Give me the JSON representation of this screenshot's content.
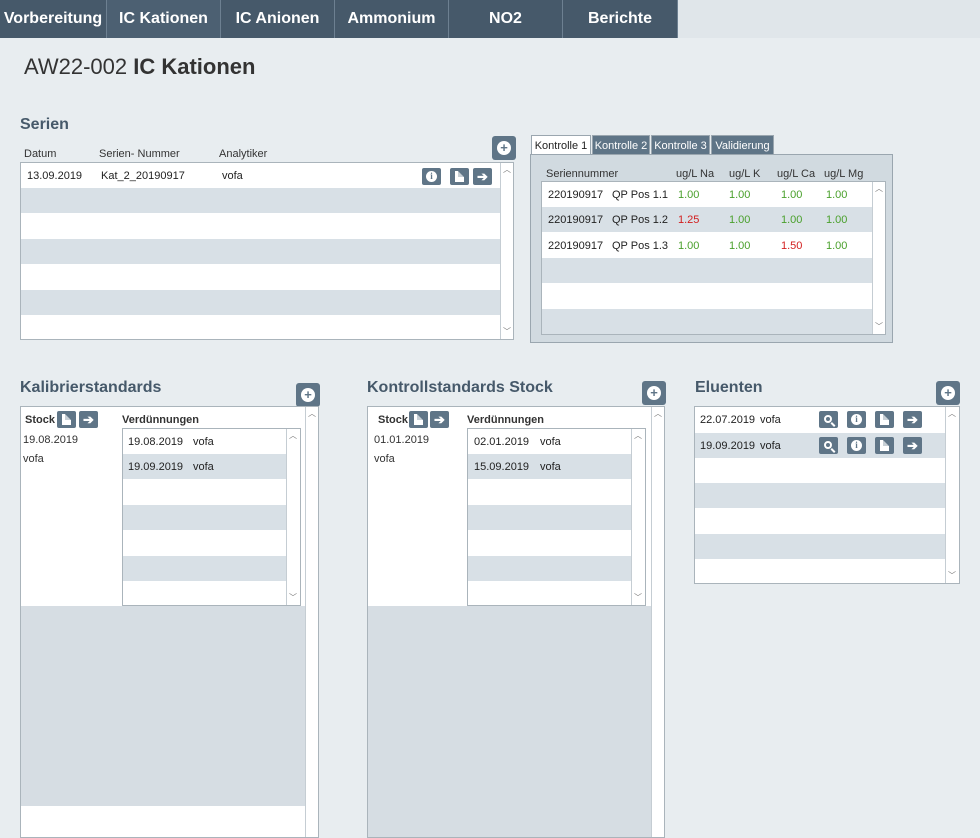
{
  "nav": {
    "tabs": [
      {
        "label": "Vorbereitung"
      },
      {
        "label": "IC Kationen"
      },
      {
        "label": "IC Anionen"
      },
      {
        "label": "Ammonium"
      },
      {
        "label": "NO2"
      },
      {
        "label": "Berichte"
      }
    ]
  },
  "page": {
    "code": "AW22-002",
    "title": "IC Kationen"
  },
  "serien": {
    "title": "Serien",
    "headers": {
      "datum": "Datum",
      "nummer": "Serien- Nummer",
      "analytiker": "Analytiker"
    },
    "rows": [
      {
        "datum": "13.09.2019",
        "nummer": "Kat_2_20190917",
        "analytiker": "vofa"
      }
    ]
  },
  "kontrolle": {
    "tabs": [
      "Kontrolle 1",
      "Kontrolle 2",
      "Kontrolle 3",
      "Validierung"
    ],
    "headers": [
      "Seriennummer",
      "ug/L Na",
      "ug/L K",
      "ug/L Ca",
      "ug/L Mg"
    ],
    "rows": [
      {
        "serie": "220190917",
        "pos": "QP Pos 1.1",
        "na": "1.00",
        "k": "1.00",
        "ca": "1.00",
        "mg": "1.00"
      },
      {
        "serie": "220190917",
        "pos": "QP Pos 1.2",
        "na": "1.25",
        "k": "1.00",
        "ca": "1.00",
        "mg": "1.00"
      },
      {
        "serie": "220190917",
        "pos": "QP Pos 1.3",
        "na": "1.00",
        "k": "1.00",
        "ca": "1.50",
        "mg": "1.00"
      }
    ]
  },
  "kalibrier": {
    "title": "Kalibrierstandards",
    "stock_label": "Stock",
    "verd_label": "Verdünnungen",
    "stock_date": "19.08.2019",
    "stock_user": "vofa",
    "rows": [
      {
        "date": "19.08.2019",
        "user": "vofa"
      },
      {
        "date": "19.09.2019",
        "user": "vofa"
      }
    ]
  },
  "kontrollstd": {
    "title": "Kontrollstandards Stock",
    "stock_label": "Stock",
    "verd_label": "Verdünnungen",
    "stock_date": "01.01.2019",
    "stock_user": "vofa",
    "rows": [
      {
        "date": "02.01.2019",
        "user": "vofa"
      },
      {
        "date": "15.09.2019",
        "user": "vofa"
      }
    ]
  },
  "eluenten": {
    "title": "Eluenten",
    "rows": [
      {
        "date": "22.07.2019",
        "user": "vofa"
      },
      {
        "date": "19.09.2019",
        "user": "vofa"
      }
    ]
  },
  "colors": {
    "nav": "#46596a",
    "button": "#5f7587",
    "ok": "#4aa02c",
    "fail": "#d21e1e"
  }
}
